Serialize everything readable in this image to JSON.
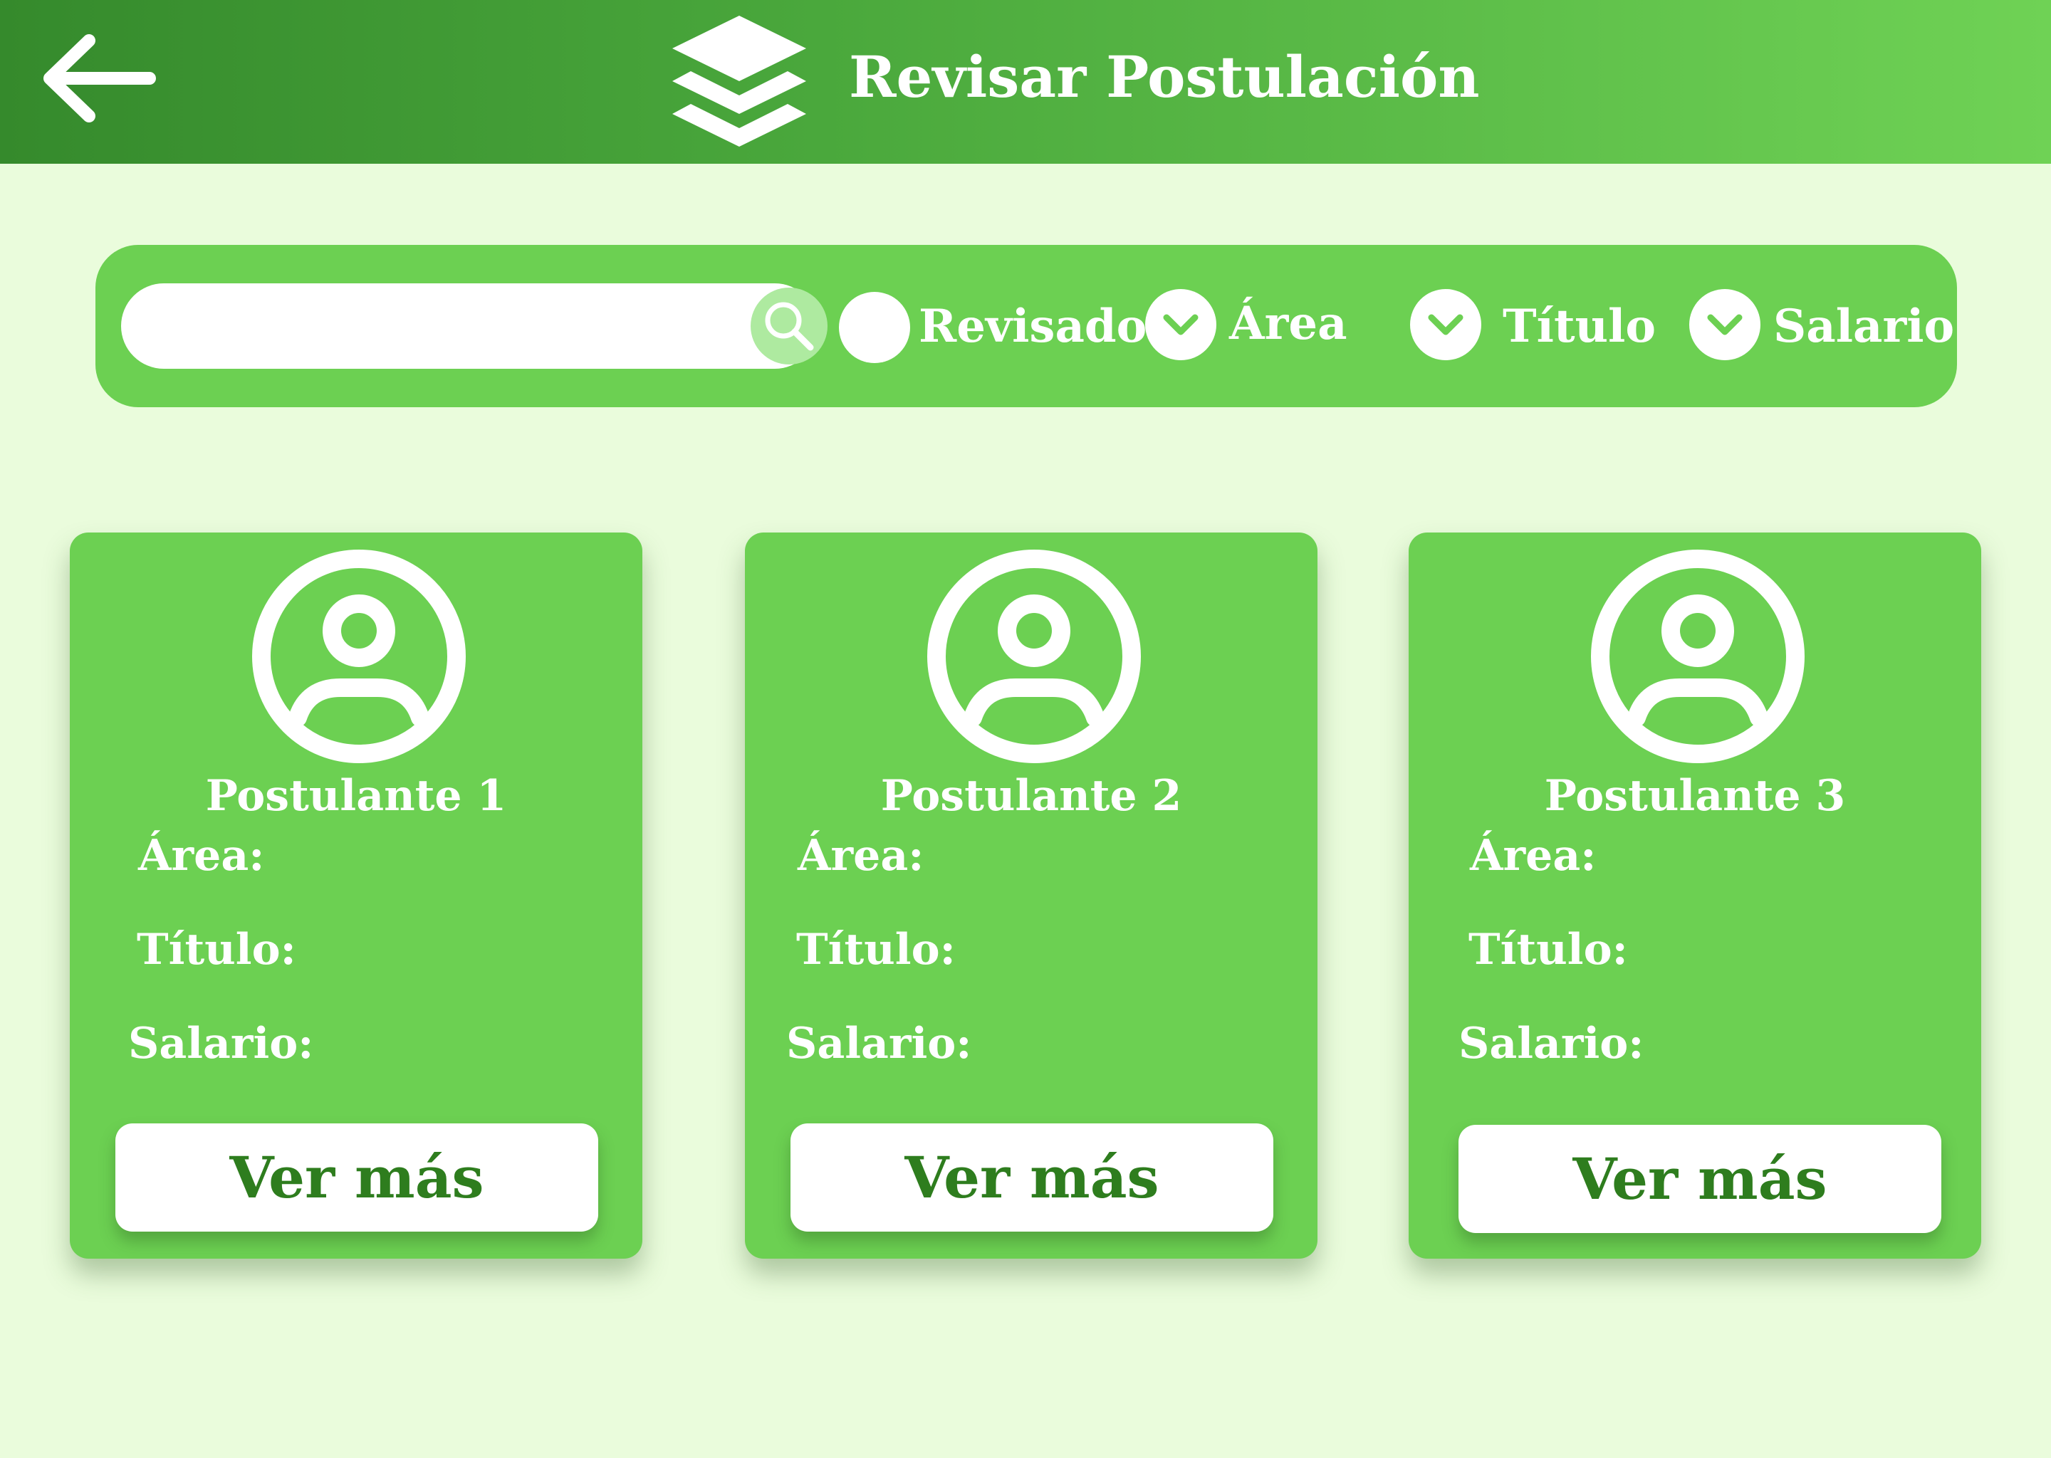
{
  "header": {
    "title": "Revisar Postulación",
    "back_icon": "arrow-left-icon",
    "logo_icon": "layers-icon"
  },
  "filters": {
    "search": {
      "placeholder": "",
      "value": "",
      "icon": "search-icon"
    },
    "revisado": {
      "label": "Revisado",
      "checked": false
    },
    "area": {
      "label": "Área",
      "icon": "chevron-down-icon"
    },
    "titulo": {
      "label": "Título",
      "icon": "chevron-down-icon"
    },
    "salario": {
      "label": "Salario",
      "icon": "chevron-down-icon"
    }
  },
  "cards": [
    {
      "name": "Postulante 1",
      "area_label": "Área:",
      "titulo_label": "Título:",
      "salario_label": "Salario:",
      "button_label": "Ver más"
    },
    {
      "name": "Postulante 2",
      "area_label": "Área:",
      "titulo_label": "Título:",
      "salario_label": "Salario:",
      "button_label": "Ver más"
    },
    {
      "name": "Postulante 3",
      "area_label": "Área:",
      "titulo_label": "Título:",
      "salario_label": "Salario:",
      "button_label": "Ver más"
    }
  ],
  "colors": {
    "header_start": "#358a2c",
    "header_end": "#6fd255",
    "background": "#eafcdc",
    "card": "#6cd052",
    "button_text": "#2e7d1e"
  }
}
